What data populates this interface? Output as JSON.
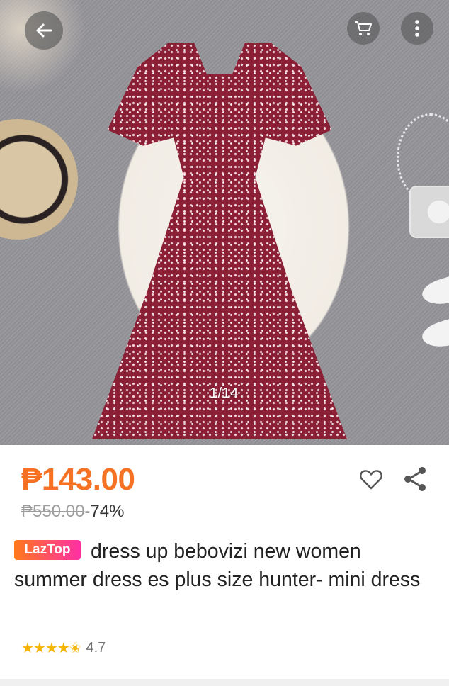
{
  "gallery": {
    "counter": "1/14",
    "back_icon": "arrow-left-icon",
    "cart_icon": "cart-icon",
    "more_icon": "more-vertical-icon"
  },
  "product": {
    "price": "₱143.00",
    "original_price": "₱550.00",
    "discount": "-74%",
    "badge": "LazTop",
    "title": "dress up bebovizi new women summer dress es plus size hunter- mini dress",
    "rating_stars": 4.7,
    "rating_value": "4.7"
  },
  "colors": {
    "price": "#f57224",
    "star": "#f5b400",
    "badge_start": "#ff7a1a",
    "badge_end": "#ff2fa4"
  }
}
